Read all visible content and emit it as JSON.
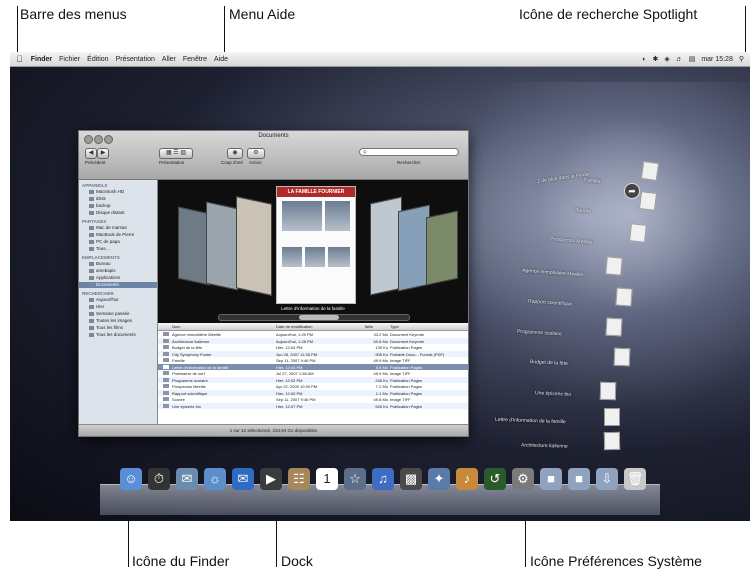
{
  "callouts": {
    "menu_bar": "Barre des menus",
    "help_menu": "Menu Aide",
    "spotlight": "Icône de recherche Spotlight",
    "finder_icon": "Icône du Finder",
    "dock": "Dock",
    "system_prefs": "Icône Préférences Système"
  },
  "menubar": {
    "apple": "",
    "items": [
      "Finder",
      "Fichier",
      "Édition",
      "Présentation",
      "Aller",
      "Fenêtre",
      "Aide"
    ],
    "clock": "mar 15:28",
    "spotlight_icon": "magnifier-icon"
  },
  "window": {
    "title": "Documents",
    "toolbar": {
      "back_label": "Précédent",
      "view_label": "Présentation",
      "quicklook_label": "Coup d'œil",
      "action_label": "Action",
      "search_label": "Rechercher"
    },
    "sidebar": {
      "appareils": {
        "heading": "APPAREILS",
        "items": [
          "Macintosh HD",
          "iDisk",
          "backup",
          "Disque distant"
        ]
      },
      "partages": {
        "heading": "PARTAGES",
        "items": [
          "Mac de maman",
          "MacBook de Pierre",
          "PC de papa",
          "Tous…"
        ]
      },
      "emplacements": {
        "heading": "EMPLACEMENTS",
        "items": [
          "Bureau",
          "amebapis",
          "Applications",
          "Documents"
        ]
      },
      "recherche": {
        "heading": "RECHERCHER",
        "items": [
          "Aujourd'hui",
          "Hier",
          "Semaine passée",
          "Toutes les images",
          "Tous les films",
          "Tous les documents"
        ]
      }
    },
    "coverflow": {
      "center_title": "LA FAMILLE FOURNIER",
      "caption": "Lettre d'information de la famille"
    },
    "list": {
      "columns": [
        "Nom",
        "Date de modification",
        "Taille",
        "Type"
      ],
      "rows": [
        [
          "Agence immobilière Mireille",
          "Aujourd'hui, 1:29 PM",
          "33.2 Mo",
          "Document Keynote"
        ],
        [
          "Architecture italienne",
          "Aujourd'hui, 1:28 PM",
          "50.8 Mo",
          "Document Keynote"
        ],
        [
          "Budget de la fête",
          "Hier, 12:04 PM",
          "139 Ko",
          "Publication Pages"
        ],
        [
          "City Symphony Poster",
          "Jun 28, 2007 11:35 PM",
          "905 Ko",
          "Portable Docu... Format (PDF)"
        ],
        [
          "Famille",
          "Sep 11, 2007 9:46 PM",
          "49.9 Mo",
          "Image TIFF"
        ],
        [
          "Lettre d'information de la famille",
          "Hier, 12:43 PM",
          "5.5 Mo",
          "Publication Pages"
        ],
        [
          "Professeur de surf",
          "Jul 27, 2007 1:58 AM",
          "49.9 Mo",
          "Image TIFF"
        ],
        [
          "Programme scolaire",
          "Hier, 12:02 PM",
          "246 Ko",
          "Publication Pages"
        ],
        [
          "Prospectus Mireille",
          "Apr 22, 2009 10:09 PM",
          "7.2 Mo",
          "Publication Pages"
        ],
        [
          "Rapport scientifique",
          "Hier, 12:00 PM",
          "1.1 Mo",
          "Publication Pages"
        ],
        [
          "Sourire",
          "Sep 11, 2007 9:46 PM",
          "49.8 Mo",
          "Image TIFF"
        ],
        [
          "Une épicerie bio",
          "Hier, 12:07 PM",
          "545 Ko",
          "Publication Pages"
        ]
      ]
    },
    "status": "1 sur 12 sélectionné, 234,94 Go disponibles"
  },
  "stack": {
    "more": "2 de plus dans le Finder",
    "items": [
      "Famille",
      "Sourire",
      "Prospectus Mireille",
      "Agence immobilière Mireille",
      "Rapport scientifique",
      "Programme scolaire",
      "Budget de la fête",
      "Une épicerie bio",
      "Lettre d'information de la famille",
      "Architecture italienne"
    ]
  },
  "dock": {
    "icons": [
      "finder-icon",
      "dashboard-icon",
      "mail-icon",
      "safari-icon",
      "ichat-icon",
      "facetime-icon",
      "address-book-icon",
      "ical-icon",
      "iphoto-icon",
      "itunes-icon",
      "imovie-icon",
      "iweb-icon",
      "garageband-icon",
      "time-machine-icon",
      "system-preferences-icon",
      "applications-folder-icon",
      "documents-stack-icon",
      "downloads-icon",
      "trash-icon"
    ]
  }
}
